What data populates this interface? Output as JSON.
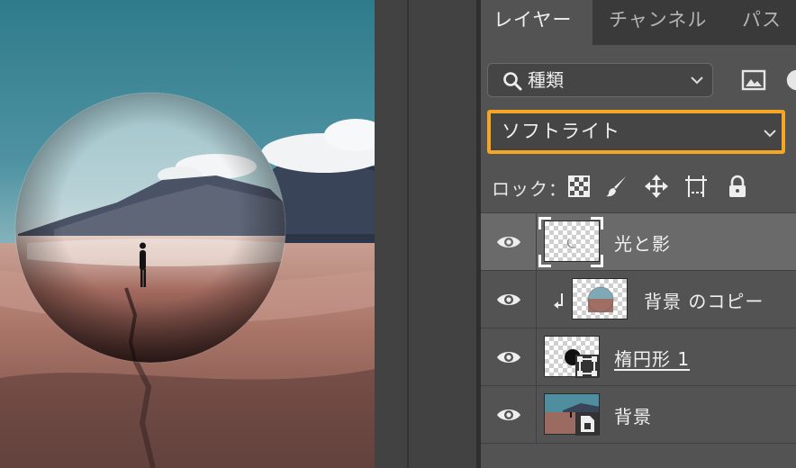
{
  "tabs": [
    {
      "label": "レイヤー",
      "active": true
    },
    {
      "label": "チャンネル",
      "active": false
    },
    {
      "label": "パス",
      "active": false
    }
  ],
  "filter": {
    "label": "種類",
    "icon": "search-icon"
  },
  "blend_mode": {
    "value": "ソフトライト",
    "highlight_color": "#f5a623"
  },
  "lock": {
    "label": "ロック："
  },
  "layers": [
    {
      "name": "光と影",
      "visible": true,
      "selected": true,
      "thumbnail": "transparent-with-moon"
    },
    {
      "name": "背景 のコピー",
      "visible": true,
      "selected": false,
      "clipped": true,
      "thumbnail": "photo"
    },
    {
      "name": "楕円形 1",
      "visible": true,
      "selected": false,
      "thumbnail": "ellipse-shape"
    },
    {
      "name": "背景",
      "visible": true,
      "selected": false,
      "thumbnail": "photo-smart-object"
    }
  ],
  "colors": {
    "panel_bg": "#535353",
    "tab_bar_bg": "#3a3a3a",
    "selected_layer_bg": "#6a6a6a",
    "accent_orange": "#f5a623"
  }
}
